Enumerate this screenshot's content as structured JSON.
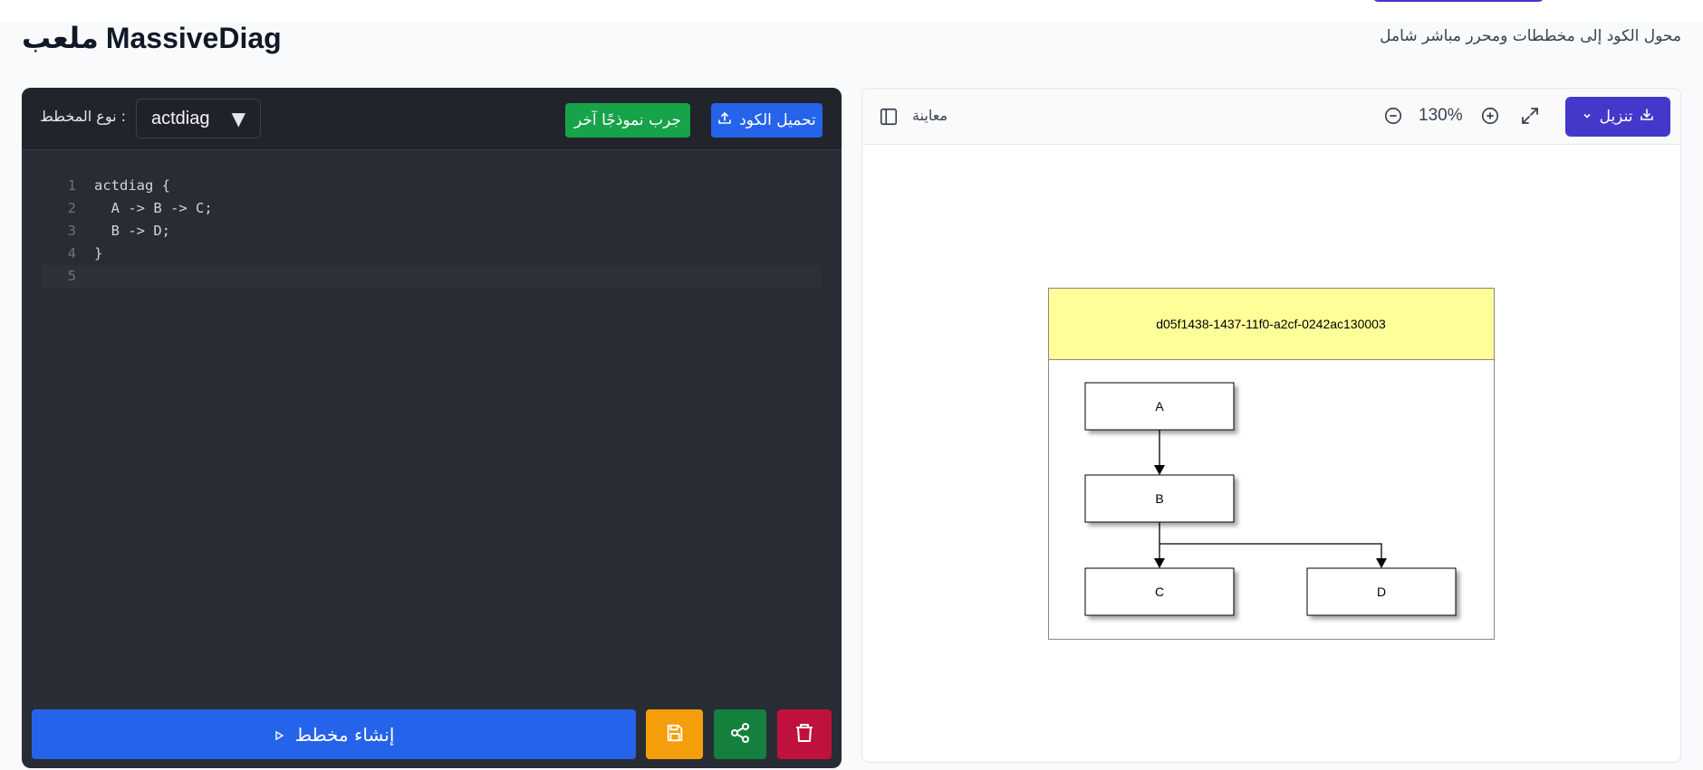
{
  "header": {
    "title_ar": "ملعب",
    "title_en": "MassiveDiag",
    "subtitle": "محول الكود إلى مخططات ومحرر مباشر شامل"
  },
  "editor": {
    "diagram_type_label": ": نوع المخطط",
    "diagram_type_value": "actdiag",
    "upload_button": "تحميل الكود",
    "try_sample_button": "جرب نموذجًا آخر",
    "code_lines": [
      {
        "num": "1",
        "text": "actdiag {"
      },
      {
        "num": "2",
        "text": "  A -> B -> C;"
      },
      {
        "num": "3",
        "text": "  B -> D;"
      },
      {
        "num": "4",
        "text": "}"
      },
      {
        "num": "5",
        "text": ""
      }
    ],
    "generate_button": "إنشاء مخطط"
  },
  "preview": {
    "label": "معاينة",
    "zoom": "130%",
    "download_button": "تنزيل"
  },
  "diagram": {
    "lane_title": "d05f1438-1437-11f0-a2cf-0242ac130003",
    "nodes": [
      "A",
      "B",
      "C",
      "D"
    ]
  },
  "colors": {
    "editor_bg": "#282c34",
    "primary_blue": "#2563eb",
    "green": "#16a34a",
    "amber": "#f59e0b",
    "dark_green": "#15803d",
    "crimson": "#be123c",
    "indigo": "#4338ca",
    "lane_header": "#ffff99"
  },
  "icons": [
    "upload-icon",
    "play-icon",
    "save-icon",
    "share-icon",
    "trash-icon",
    "sidebar-toggle-icon",
    "zoom-out-icon",
    "zoom-in-icon",
    "expand-icon",
    "download-icon",
    "chevron-down-icon",
    "caret-down-icon"
  ]
}
